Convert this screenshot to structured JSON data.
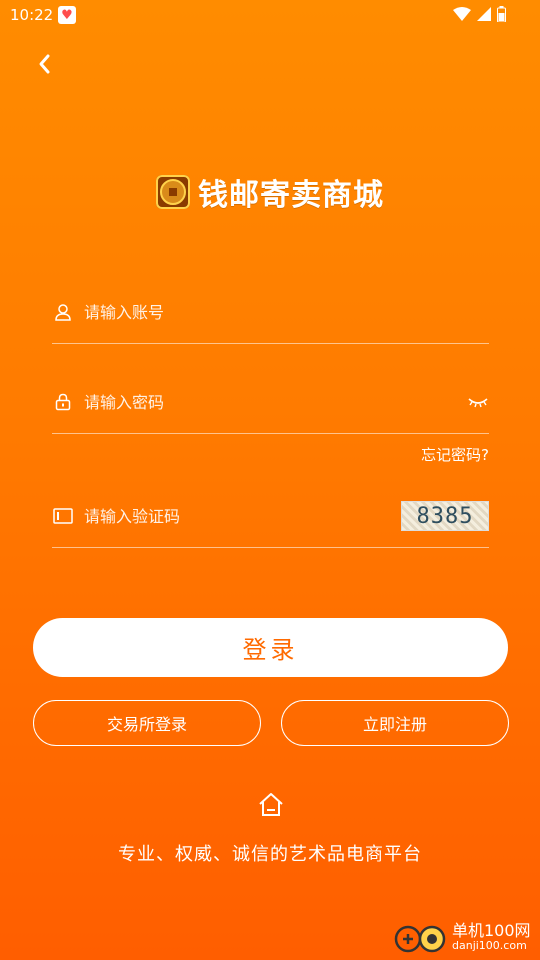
{
  "status": {
    "time": "10:22"
  },
  "header": {
    "brand_name": "钱邮寄卖商城",
    "logo_glyph": "钱"
  },
  "form": {
    "account_placeholder": "请输入账号",
    "password_placeholder": "请输入密码",
    "forgot_label": "忘记密码?",
    "captcha_placeholder": "请输入验证码",
    "captcha_code": "8385"
  },
  "actions": {
    "login_label": "登录",
    "exchange_login_label": "交易所登录",
    "register_label": "立即注册"
  },
  "footer": {
    "tagline": "专业、权威、诚信的艺术品电商平台"
  },
  "watermark": {
    "name": "单机100网",
    "url": "danji100.com"
  },
  "colors": {
    "accent": "#ff7a00",
    "button_text": "#ff6a00"
  }
}
